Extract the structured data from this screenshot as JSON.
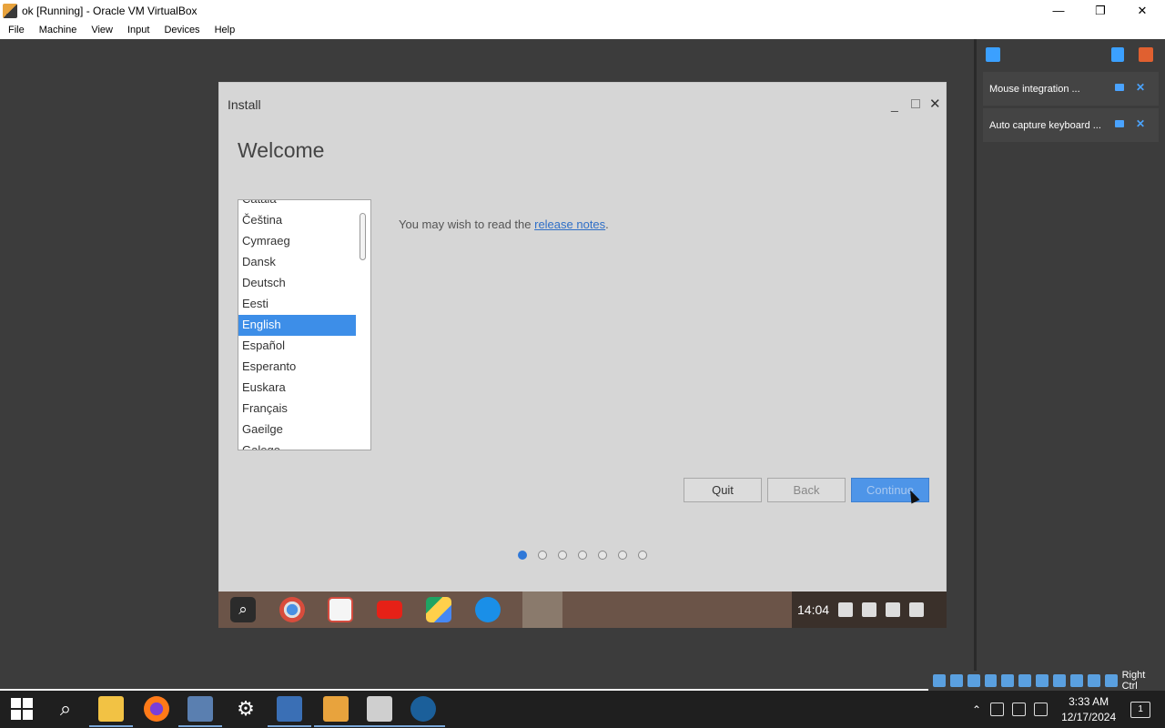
{
  "host_window": {
    "title": "ok [Running] - Oracle VM VirtualBox",
    "controls": {
      "minimize": "—",
      "restore": "❐",
      "close": "✕"
    }
  },
  "menubar": {
    "items": [
      {
        "label": "File"
      },
      {
        "label": "Machine"
      },
      {
        "label": "View"
      },
      {
        "label": "Input"
      },
      {
        "label": "Devices"
      },
      {
        "label": "Help"
      }
    ]
  },
  "notification_panel": {
    "items": [
      {
        "text": "Mouse integration ..."
      },
      {
        "text": "Auto capture keyboard ..."
      }
    ]
  },
  "host_statusbar": {
    "host_key": "Right Ctrl"
  },
  "installer": {
    "window_title": "Install",
    "heading": "Welcome",
    "languages": [
      "Català",
      "Čeština",
      "Cymraeg",
      "Dansk",
      "Deutsch",
      "Eesti",
      "English",
      "Español",
      "Esperanto",
      "Euskara",
      "Français",
      "Gaeilge",
      "Galego"
    ],
    "selected_language": "English",
    "release_prefix": "You may wish to read the ",
    "release_link": "release notes",
    "release_suffix": ".",
    "buttons": {
      "quit": "Quit",
      "back": "Back",
      "continue": "Continue"
    },
    "progress": {
      "total_steps": 7,
      "current_step": 1
    }
  },
  "guest_shelf": {
    "time": "14:04",
    "apps": [
      "search-icon",
      "chrome-icon",
      "gmail-icon",
      "youtube-icon",
      "drive-icon",
      "files-icon",
      "installer-icon"
    ]
  },
  "windows_taskbar": {
    "time": "3:33 AM",
    "date": "12/17/2024",
    "notification_count": "1",
    "apps": [
      "start-icon",
      "search-icon",
      "file-explorer-icon",
      "firefox-icon",
      "app-icon",
      "settings-icon",
      "virtualbox-icon",
      "virtualbox-vm-icon",
      "app-icon",
      "steam-icon"
    ]
  }
}
